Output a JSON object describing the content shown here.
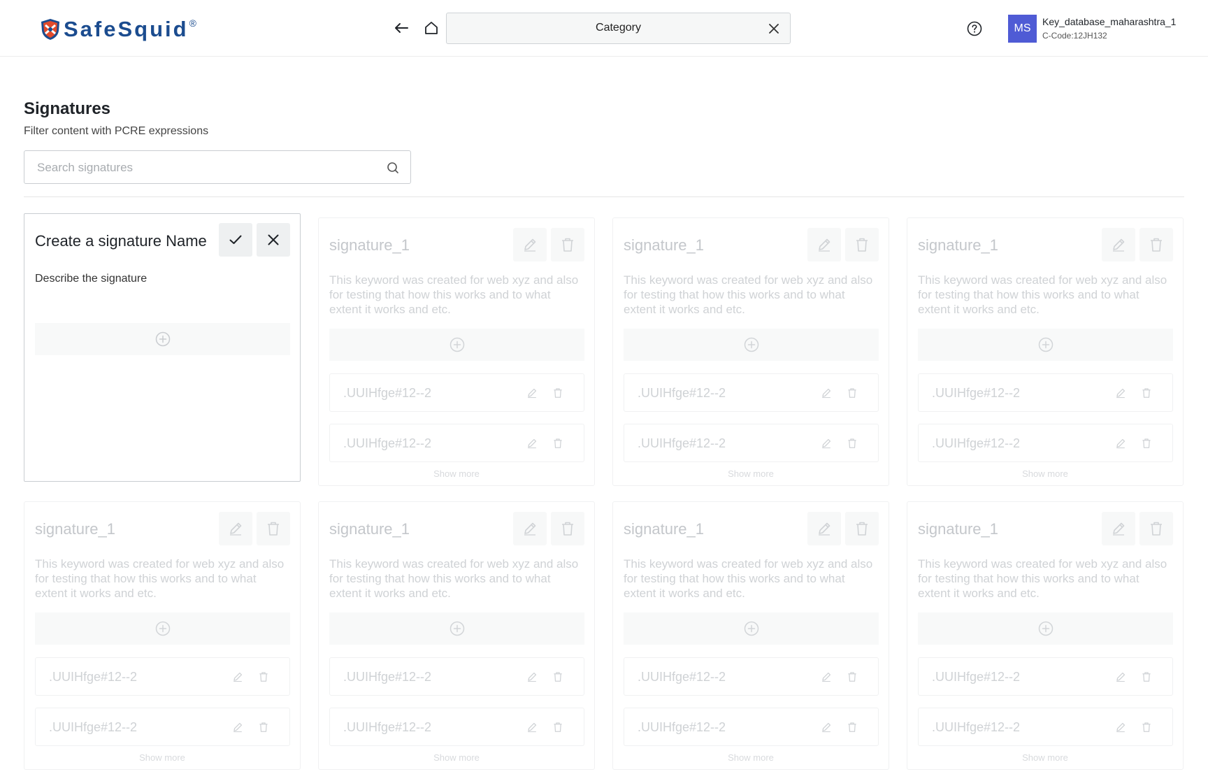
{
  "header": {
    "logo_text": "SafeSquid",
    "logo_mark": "®",
    "category_label": "Category",
    "user": {
      "initials": "MS",
      "name": "Key_database_maharashtra_1",
      "code": "C-Code:12JH132"
    },
    "icons": [
      "arrow-left-icon",
      "home-icon",
      "close-icon",
      "help-circle-icon"
    ]
  },
  "page": {
    "title": "Signatures",
    "subtitle": "Filter content with PCRE expressions",
    "search_placeholder": "Search signatures"
  },
  "new_card": {
    "title": "Create a signature Name",
    "description": "Describe the signature"
  },
  "cards": [
    {
      "title": "signature_1",
      "description": "This keyword was created for web xyz and also for testing that how this works and to what extent it works and etc.",
      "items": [
        ".UUIHfge#12--2",
        ".UUIHfge#12--2"
      ],
      "show_more": "Show more"
    },
    {
      "title": "signature_1",
      "description": "This keyword was created for web xyz and also for testing that how this works and to what extent it works and etc.",
      "items": [
        ".UUIHfge#12--2",
        ".UUIHfge#12--2"
      ],
      "show_more": "Show more"
    },
    {
      "title": "signature_1",
      "description": "This keyword was created for web xyz and also for testing that how this works and to what extent it works and etc.",
      "items": [
        ".UUIHfge#12--2",
        ".UUIHfge#12--2"
      ],
      "show_more": "Show more"
    },
    {
      "title": "signature_1",
      "description": "This keyword was created for web xyz and also for testing that how this works and to what extent it works and etc.",
      "items": [
        ".UUIHfge#12--2",
        ".UUIHfge#12--2"
      ],
      "show_more": "Show more"
    },
    {
      "title": "signature_1",
      "description": "This keyword was created for web xyz and also for testing that how this works and to what extent it works and etc.",
      "items": [
        ".UUIHfge#12--2",
        ".UUIHfge#12--2"
      ],
      "show_more": "Show more"
    },
    {
      "title": "signature_1",
      "description": "This keyword was created for web xyz and also for testing that how this works and to what extent it works and etc.",
      "items": [
        ".UUIHfge#12--2",
        ".UUIHfge#12--2"
      ],
      "show_more": "Show more"
    },
    {
      "title": "signature_1",
      "description": "This keyword was created for web xyz and also for testing that how this works and to what extent it works and etc.",
      "items": [
        ".UUIHfge#12--2",
        ".UUIHfge#12--2"
      ],
      "show_more": "Show more"
    }
  ],
  "colors": {
    "brand": "#1b4c8f",
    "avatar_bg": "#4f5bd5",
    "faded_text": "#c4c7cb"
  }
}
